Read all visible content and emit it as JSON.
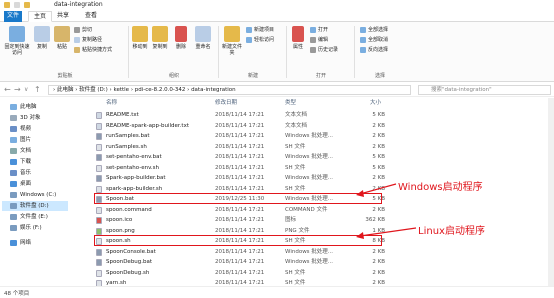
{
  "window": {
    "title": "data-integration",
    "colors": {
      "accent": "#1979ca",
      "highlight": "#e0161d",
      "selected": "#cce8ff"
    }
  },
  "tabs": [
    "文件",
    "主页",
    "共享",
    "查看"
  ],
  "ribbon": {
    "pin": "固定到快速访问",
    "copy": "复制",
    "paste": "粘贴",
    "cut": "剪切",
    "copy_path": "复制路径",
    "paste_shortcut": "粘贴快捷方式",
    "move_to": "移动到",
    "copy_to": "复制到",
    "delete": "删除",
    "rename": "重命名",
    "new_folder": "新建文件夹",
    "new_item": "新建项目",
    "easy_access": "轻松访问",
    "properties": "属性",
    "open": "打开",
    "edit": "编辑",
    "history": "历史记录",
    "select_all": "全部选择",
    "select_none": "全部取消",
    "invert": "反向选择",
    "groups": {
      "clipboard": "剪贴板",
      "organize": "组织",
      "new": "新建",
      "open": "打开",
      "select": "选择"
    }
  },
  "address": {
    "path": "› 此电脑 › 软件盘 (D:) › kettle › pdi-ce-8.2.0.0-342 › data-integration",
    "search_placeholder": "搜索\"data-integration\""
  },
  "nav": [
    {
      "label": "此电脑",
      "icon": "computer-icon"
    },
    {
      "label": "3D 对象",
      "icon": "3d-objects-icon"
    },
    {
      "label": "视频",
      "icon": "video-icon"
    },
    {
      "label": "图片",
      "icon": "picture-icon"
    },
    {
      "label": "文档",
      "icon": "document-icon"
    },
    {
      "label": "下载",
      "icon": "download-icon"
    },
    {
      "label": "音乐",
      "icon": "music-icon"
    },
    {
      "label": "桌面",
      "icon": "desktop-icon"
    },
    {
      "label": "Windows (C:)",
      "icon": "drive-icon"
    },
    {
      "label": "软件盘 (D:)",
      "icon": "drive-icon",
      "selected": true
    },
    {
      "label": "文件盘 (E:)",
      "icon": "drive-icon"
    },
    {
      "label": "娱乐 (F:)",
      "icon": "drive-icon"
    },
    {
      "label": "网络",
      "icon": "network-icon"
    }
  ],
  "columns": {
    "name": "名称",
    "date": "修改日期",
    "type": "类型",
    "size": "大小"
  },
  "files": [
    {
      "name": "README.txt",
      "date": "2018/11/14 17:21",
      "type": "文本文档",
      "size": "5 KB",
      "icon": "txt"
    },
    {
      "name": "README-spark-app-builder.txt",
      "date": "2018/11/14 17:21",
      "type": "文本文档",
      "size": "2 KB",
      "icon": "txt"
    },
    {
      "name": "runSamples.bat",
      "date": "2018/11/14 17:21",
      "type": "Windows 批处理...",
      "size": "2 KB",
      "icon": "bat"
    },
    {
      "name": "runSamples.sh",
      "date": "2018/11/14 17:21",
      "type": "SH 文件",
      "size": "2 KB",
      "icon": "sh"
    },
    {
      "name": "set-pentaho-env.bat",
      "date": "2018/11/14 17:21",
      "type": "Windows 批处理...",
      "size": "5 KB",
      "icon": "bat"
    },
    {
      "name": "set-pentaho-env.sh",
      "date": "2018/11/14 17:21",
      "type": "SH 文件",
      "size": "5 KB",
      "icon": "sh"
    },
    {
      "name": "Spark-app-builder.bat",
      "date": "2018/11/14 17:21",
      "type": "Windows 批处理...",
      "size": "2 KB",
      "icon": "bat"
    },
    {
      "name": "spark-app-builder.sh",
      "date": "2018/11/14 17:21",
      "type": "SH 文件",
      "size": "2 KB",
      "icon": "sh"
    },
    {
      "name": "Spoon.bat",
      "date": "2019/12/25 11:30",
      "type": "Windows 批处理...",
      "size": "5 KB",
      "icon": "bat",
      "highlight": true
    },
    {
      "name": "spoon.command",
      "date": "2018/11/14 17:21",
      "type": "COMMAND 文件",
      "size": "2 KB",
      "icon": "sh"
    },
    {
      "name": "spoon.ico",
      "date": "2018/11/14 17:21",
      "type": "图标",
      "size": "362 KB",
      "icon": "ico"
    },
    {
      "name": "spoon.png",
      "date": "2018/11/14 17:21",
      "type": "PNG 文件",
      "size": "1 KB",
      "icon": "png"
    },
    {
      "name": "spoon.sh",
      "date": "2018/11/14 17:21",
      "type": "SH 文件",
      "size": "8 KB",
      "icon": "sh",
      "highlight": true
    },
    {
      "name": "SpoonConsole.bat",
      "date": "2018/11/14 17:21",
      "type": "Windows 批处理...",
      "size": "2 KB",
      "icon": "bat"
    },
    {
      "name": "SpoonDebug.bat",
      "date": "2018/11/14 17:21",
      "type": "Windows 批处理...",
      "size": "2 KB",
      "icon": "bat"
    },
    {
      "name": "SpoonDebug.sh",
      "date": "2018/11/14 17:21",
      "type": "SH 文件",
      "size": "2 KB",
      "icon": "sh"
    },
    {
      "name": "yarn.sh",
      "date": "2018/11/14 17:21",
      "type": "SH 文件",
      "size": "2 KB",
      "icon": "sh"
    }
  ],
  "annotations": {
    "windows": "Windows启动程序",
    "linux": "Linux启动程序"
  },
  "status": {
    "count": "48 个项目"
  }
}
